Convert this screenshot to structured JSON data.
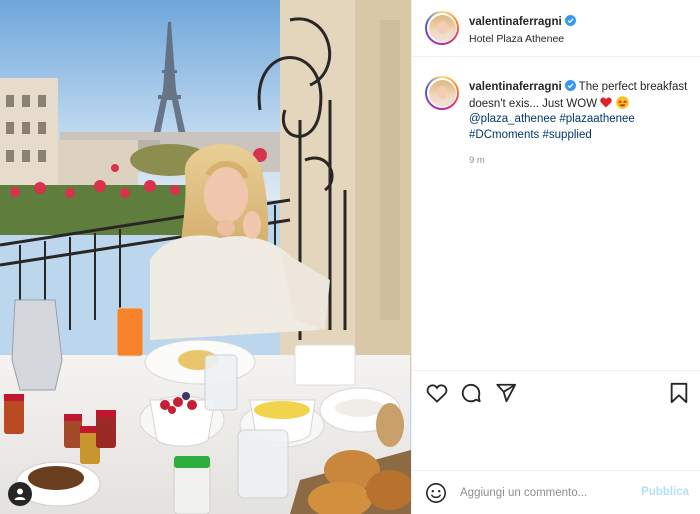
{
  "post": {
    "username": "valentinaferragni",
    "location": "Hotel Plaza Athenee",
    "caption": {
      "text": "The perfect breakfast doesn't exis... Just WOW",
      "emojis": [
        "heart",
        "heart-eyes"
      ],
      "mention": "@plaza_athenee",
      "hashtags": [
        "#plazaathenee",
        "#DCmoments",
        "#supplied"
      ]
    },
    "time_ago": "9 m"
  },
  "actions": {
    "like_icon": "heart-outline",
    "comment_icon": "speech-bubble",
    "share_icon": "paper-plane",
    "save_icon": "bookmark-outline"
  },
  "comment_box": {
    "placeholder": "Aggiungi un commento...",
    "publish_label": "Pubblica"
  },
  "colors": {
    "link": "#00376b",
    "verified": "#3897f0",
    "publish_disabled": "#b2dffc",
    "muted_text": "#8e8e8e"
  }
}
